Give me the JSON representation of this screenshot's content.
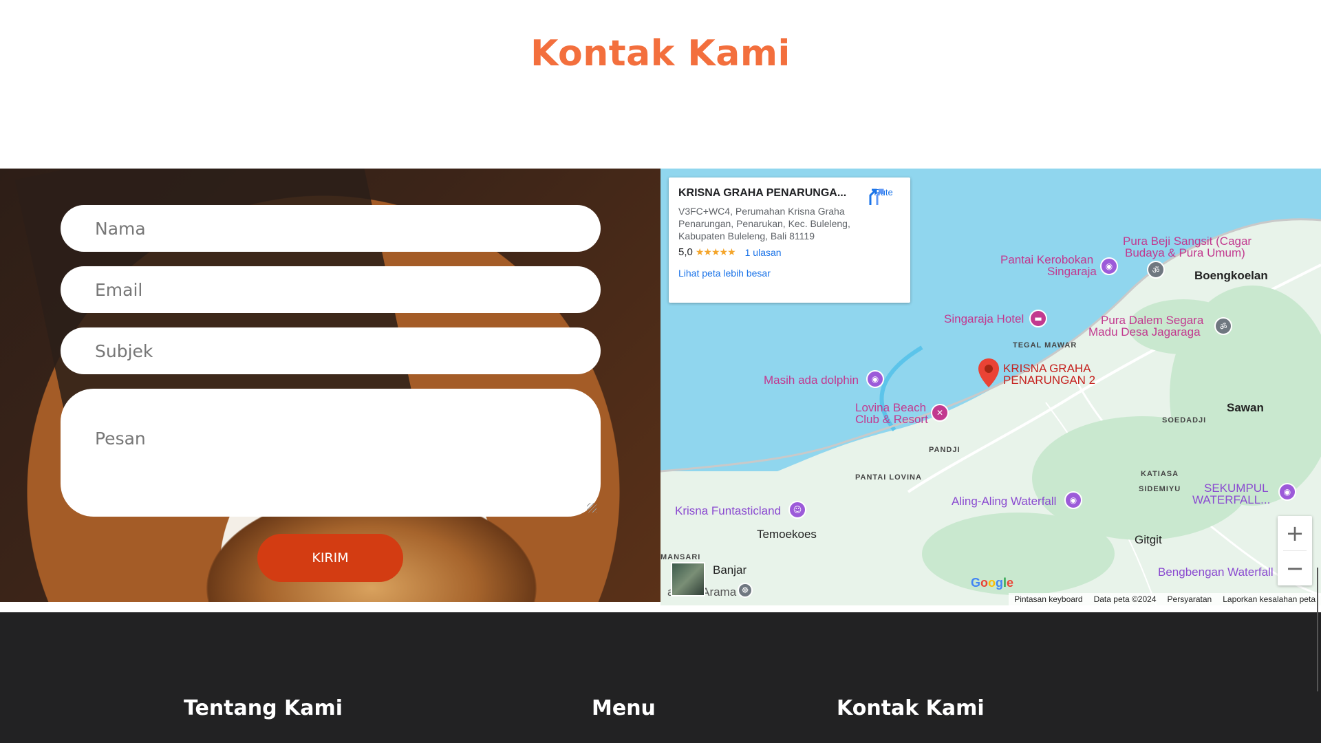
{
  "page": {
    "section_title": "Kontak Kami"
  },
  "form": {
    "name_placeholder": "Nama",
    "email_placeholder": "Email",
    "subject_placeholder": "Subjek",
    "message_placeholder": "Pesan",
    "submit_label": "KIRIM"
  },
  "map": {
    "place_name": "KRISNA GRAHA PENARUNGA...",
    "address": "V3FC+WC4, Perumahan Krisna Graha Penarungan, Penarukan, Kec. Buleleng, Kabupaten Buleleng, Bali 81119",
    "rating": "5,0",
    "stars": "★★★★★",
    "reviews": "1 ulasan",
    "bigger_map_link": "Lihat peta lebih besar",
    "route_label": "Rute",
    "marker_label_1": "KRISNA GRAHA",
    "marker_label_2": "PENARUNGAN 2",
    "labels": {
      "pura_beji_1": "Pura Beji Sangsit (Cagar",
      "pura_beji_2": "Budaya & Pura Umum)",
      "pantai_kerobokan_1": "Pantai Kerobokan",
      "pantai_kerobokan_2": "Singaraja",
      "boengkoelan": "Boengkoelan",
      "singaraja_hotel": "Singaraja Hotel",
      "pura_dalem_1": "Pura Dalem Segara",
      "pura_dalem_2": "Madu Desa Jagaraga",
      "tegal_mawar": "TEGAL MAWAR",
      "masih_ada_dolphin": "Masih ada dolphin",
      "lovina_beach_1": "Lovina Beach",
      "lovina_beach_2": "Club & Resort",
      "sawan": "Sawan",
      "soedadji": "SOEDADJI",
      "pandji": "PANDJI",
      "pantai_lovina": "PANTAI LOVINA",
      "katiasa": "KATIASA",
      "sidemiyu": "SIDEMIYU",
      "sekumpul_1": "SEKUMPUL",
      "sekumpul_2": "WATERFALL...",
      "aling_aling": "Aling-Aling Waterfall",
      "krisna_funtasticland": "Krisna Funtasticland",
      "temoekoes": "Temoekoes",
      "gitgit": "Gitgit",
      "bengbengan": "Bengbengan Waterfall",
      "mansari": "MANSARI",
      "banjar": "Banjar",
      "arama": "avana Arama"
    },
    "zoom_in": "+",
    "zoom_out": "−",
    "google_logo": "Google",
    "attribution": {
      "shortcuts": "Pintasan keyboard",
      "data": "Data peta ©2024",
      "terms": "Persyaratan",
      "report": "Laporkan kesalahan peta"
    },
    "colors": {
      "sea": "#90d6ee",
      "land": "#e8f3ea",
      "green": "#c9e8cf",
      "poi_pink": "#c2398f",
      "poi_purple": "#8a4ad0",
      "marker": "#ea4335"
    }
  },
  "footer": {
    "about_heading": "Tentang Kami",
    "menu_heading": "Menu",
    "contact_heading": "Kontak Kami"
  },
  "colors": {
    "accent": "#f36f3d",
    "button": "#d33c12",
    "footer_bg": "#222223"
  }
}
